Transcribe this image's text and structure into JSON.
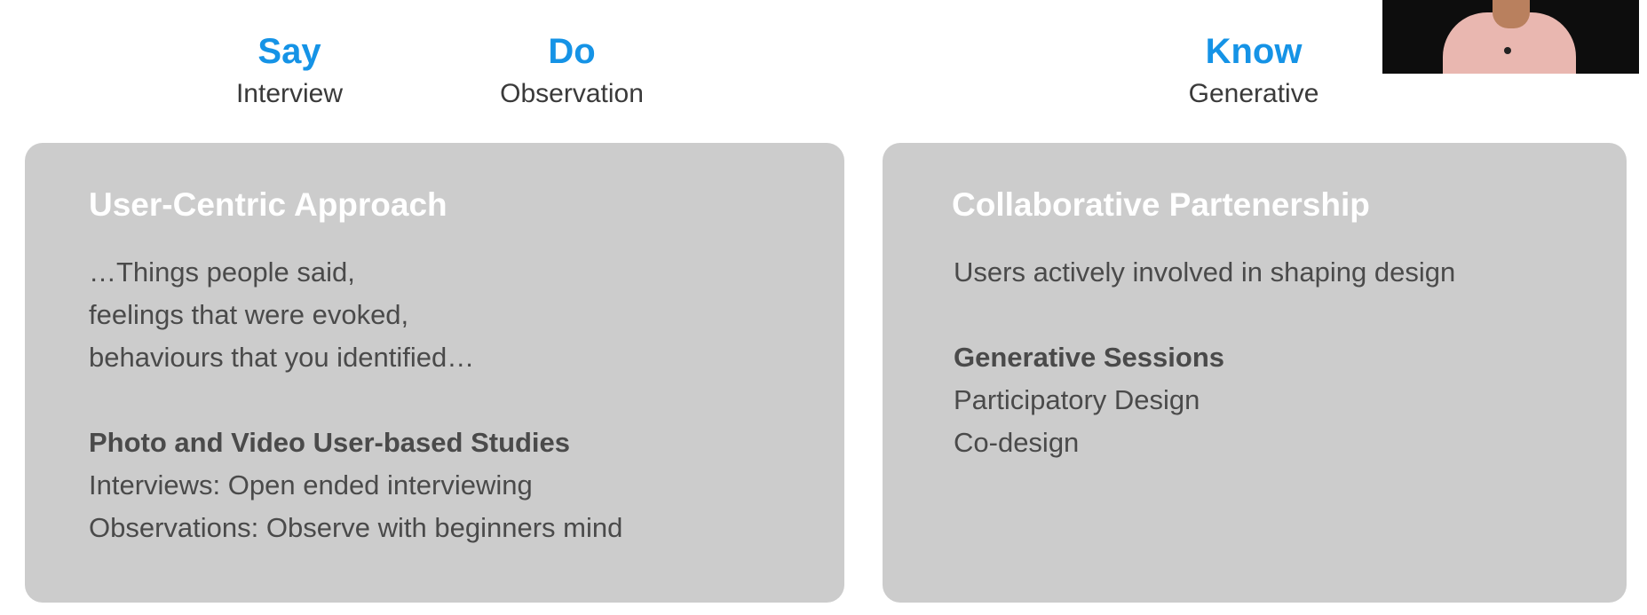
{
  "columns": {
    "say": {
      "title": "Say",
      "subtitle": "Interview"
    },
    "do": {
      "title": "Do",
      "subtitle": "Observation"
    },
    "know": {
      "title": "Know",
      "subtitle": "Generative"
    }
  },
  "cards": {
    "left": {
      "title": "User-Centric Approach",
      "lines": [
        "…Things people said,",
        "feelings that were evoked,",
        "behaviours that you identified…"
      ],
      "section_heading": "Photo and Video User-based Studies",
      "section_lines": [
        "Interviews: Open ended interviewing",
        "Observations: Observe with beginners mind"
      ]
    },
    "right": {
      "title": "Collaborative Partenership",
      "lines": [
        "Users actively involved in shaping design"
      ],
      "section_heading": "Generative Sessions",
      "section_lines": [
        "Participatory Design",
        "Co-design"
      ]
    }
  },
  "colors": {
    "accent": "#1593e6",
    "card_background": "#cccccc",
    "card_title": "#ffffff",
    "body_text": "#4a4a4a"
  }
}
